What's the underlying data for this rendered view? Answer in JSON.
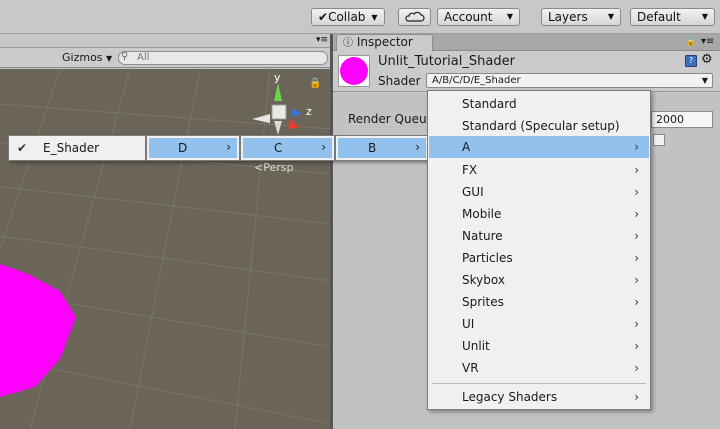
{
  "toolbar": {
    "collab_label": "Collab",
    "account_label": "Account",
    "layers_label": "Layers",
    "layout_label": "Default"
  },
  "scene": {
    "gizmos_label": "Gizmos",
    "search_placeholder": "All",
    "persp_label": "Persp",
    "axis_y": "y",
    "axis_z": "z"
  },
  "inspector": {
    "tab_label": "Inspector",
    "material_name": "Unlit_Tutorial_Shader",
    "shader_label": "Shader",
    "shader_value": "A/B/C/D/E_Shader",
    "render_queue_label": "Render Queue",
    "render_queue_value": "2000",
    "swatch_color": "#ff00ff"
  },
  "breadcrumb": [
    {
      "label": "E_Shader",
      "checked": true
    },
    {
      "label": "D"
    },
    {
      "label": "C"
    },
    {
      "label": "B"
    }
  ],
  "menu": {
    "items": [
      {
        "label": "Standard",
        "submenu": false
      },
      {
        "label": "Standard (Specular setup)",
        "submenu": false
      },
      {
        "label": "A",
        "submenu": true,
        "highlighted": true
      },
      {
        "label": "FX",
        "submenu": true
      },
      {
        "label": "GUI",
        "submenu": true
      },
      {
        "label": "Mobile",
        "submenu": true
      },
      {
        "label": "Nature",
        "submenu": true
      },
      {
        "label": "Particles",
        "submenu": true
      },
      {
        "label": "Skybox",
        "submenu": true
      },
      {
        "label": "Sprites",
        "submenu": true
      },
      {
        "label": "UI",
        "submenu": true
      },
      {
        "label": "Unlit",
        "submenu": true
      },
      {
        "label": "VR",
        "submenu": true
      }
    ],
    "legacy": {
      "label": "Legacy Shaders",
      "submenu": true
    },
    "highlight_color": "#91c1ec"
  }
}
